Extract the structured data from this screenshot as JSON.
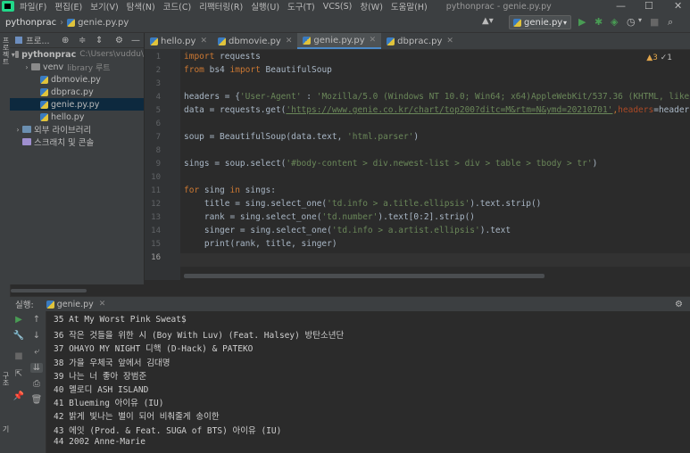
{
  "menubar": {
    "items": [
      "파일(F)",
      "편집(E)",
      "보기(V)",
      "탐색(N)",
      "코드(C)",
      "리팩터링(R)",
      "실행(U)",
      "도구(T)",
      "VCS(S)",
      "창(W)",
      "도움말(H)"
    ],
    "window_title": "pythonprac - genie.py.py",
    "minimize": "—",
    "maximize": "☐",
    "close": "✕"
  },
  "navbar": {
    "project": "pythonprac",
    "file": "genie.py.py",
    "run_config": "genie.py",
    "user_icon": "▲▾"
  },
  "project_panel": {
    "title": "프로...",
    "items": [
      {
        "label": "pythonprac",
        "extra": "C:\\Users\\vuddu\\",
        "indent": 0,
        "arrow": "▾",
        "icon": "folder"
      },
      {
        "label": "venv",
        "extra": "library 루트",
        "indent": 1,
        "arrow": "›",
        "icon": "folder"
      },
      {
        "label": "dbmovie.py",
        "extra": "",
        "indent": 2,
        "arrow": "",
        "icon": "python"
      },
      {
        "label": "dbprac.py",
        "extra": "",
        "indent": 2,
        "arrow": "",
        "icon": "python"
      },
      {
        "label": "genie.py.py",
        "extra": "",
        "indent": 2,
        "arrow": "",
        "icon": "python",
        "selected": true
      },
      {
        "label": "hello.py",
        "extra": "",
        "indent": 2,
        "arrow": "",
        "icon": "python"
      },
      {
        "label": "외부 라이브러리",
        "extra": "",
        "indent": 0,
        "arrow": "›",
        "icon": "library"
      },
      {
        "label": "스크래치 및 콘솔",
        "extra": "",
        "indent": 0,
        "arrow": "",
        "icon": "scratch"
      }
    ]
  },
  "tabs": [
    {
      "label": "hello.py",
      "active": false
    },
    {
      "label": "dbmovie.py",
      "active": false
    },
    {
      "label": "genie.py.py",
      "active": true
    },
    {
      "label": "dbprac.py",
      "active": false
    }
  ],
  "editor": {
    "warnings": "▲3",
    "weak_warnings": "✓1",
    "line_numbers": [
      "1",
      "2",
      "3",
      "4",
      "5",
      "6",
      "7",
      "8",
      "9",
      "10",
      "11",
      "12",
      "13",
      "14",
      "15",
      "16"
    ],
    "code": {
      "l1_kw": "import",
      "l1_rest": " requests",
      "l2_kw1": "from",
      "l2_mod": " bs4 ",
      "l2_kw2": "import",
      "l2_rest": " BeautifulSoup",
      "l4_a": "headers = {",
      "l4_key": "'User-Agent'",
      "l4_b": " : ",
      "l4_val": "'Mozilla/5.0 (Windows NT 10.0; Win64; x64)AppleWebKit/537.36 (KHTML, like Gec",
      "l5_a": "data = requests.get(",
      "l5_url": "'https://www.genie.co.kr/chart/top200?ditc=M&rtm=N&ymd=20210701'",
      "l5_b": ",",
      "l5_arg": "headers",
      "l5_c": "=headers)",
      "l7_a": "soup = BeautifulSoup(data.text, ",
      "l7_s": "'html.parser'",
      "l7_b": ")",
      "l9_a": "sings = soup.select(",
      "l9_s": "'#body-content > div.newest-list > div > table > tbody > tr'",
      "l9_b": ")",
      "l11_kw1": "for",
      "l11_a": " sing ",
      "l11_kw2": "in",
      "l11_b": " sings:",
      "l12_a": "    title = sing.select_one(",
      "l12_s": "'td.info > a.title.ellipsis'",
      "l12_b": ").text.strip()",
      "l13_a": "    rank = sing.select_one(",
      "l13_s": "'td.number'",
      "l13_b": ").text[0:2].strip()",
      "l14_a": "    singer = sing.select_one(",
      "l14_s": "'td.info > a.artist.ellipsis'",
      "l14_b": ").text",
      "l15_a": "    print(rank, title, singer)"
    }
  },
  "run_panel": {
    "label": "실행:",
    "tab": "genie.py",
    "gear": "⚙",
    "output": [
      "35 At My Worst Pink Sweat$",
      "36 작은 것들을 위한 시 (Boy With Luv) (Feat. Halsey) 방탄소년단",
      "37 OHAYO MY NIGHT 디핵 (D-Hack) & PATEKO",
      "38 가을 우체국 앞에서 김대명",
      "39 나는 너 좋아 장범준",
      "40 멜로디 ASH ISLAND",
      "41 Blueming 아이유 (IU)",
      "42 밝게 빛나는 별이 되어 비춰줄게 송이한",
      "43 에잇 (Prod. & Feat. SUGA of BTS) 아이유 (IU)",
      "44 2002 Anne-Marie"
    ]
  },
  "colors": {
    "accent": "#4a88c7",
    "run_green": "#499c54",
    "keyword": "#cc7832",
    "string": "#6a8759"
  }
}
